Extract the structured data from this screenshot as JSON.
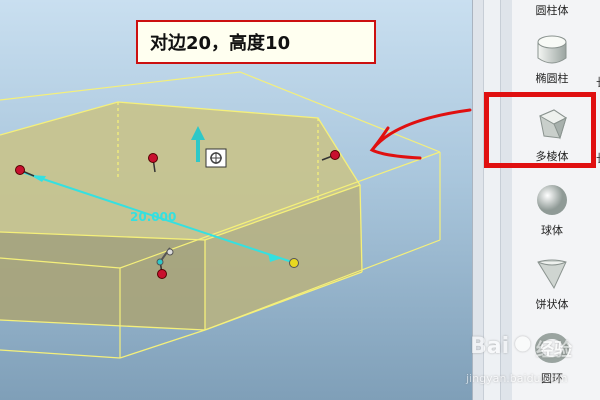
{
  "annotation": {
    "text": "对边20，高度10"
  },
  "viewport": {
    "dimension_label": "20.000"
  },
  "palette": {
    "items": [
      {
        "label": "圆柱体",
        "icon": "cylinder-icon"
      },
      {
        "label": "椭圆柱",
        "icon": "elliptic-cylinder-icon"
      },
      {
        "label": "多棱体",
        "icon": "prism-icon"
      },
      {
        "label": "球体",
        "icon": "sphere-icon"
      },
      {
        "label": "饼状体",
        "icon": "pie-icon"
      },
      {
        "label": "圆环",
        "icon": "torus-icon"
      }
    ],
    "edge_marks": [
      "",
      "长",
      "长",
      "",
      "",
      ""
    ]
  },
  "watermark": {
    "brand": "Bai",
    "brand2": "经验",
    "url": "jingyan.baidu.com"
  },
  "colors": {
    "highlight": "#e01010",
    "wireframe": "#f5f07a",
    "solid": "#c9c48a",
    "dimension": "#35e0e0"
  }
}
